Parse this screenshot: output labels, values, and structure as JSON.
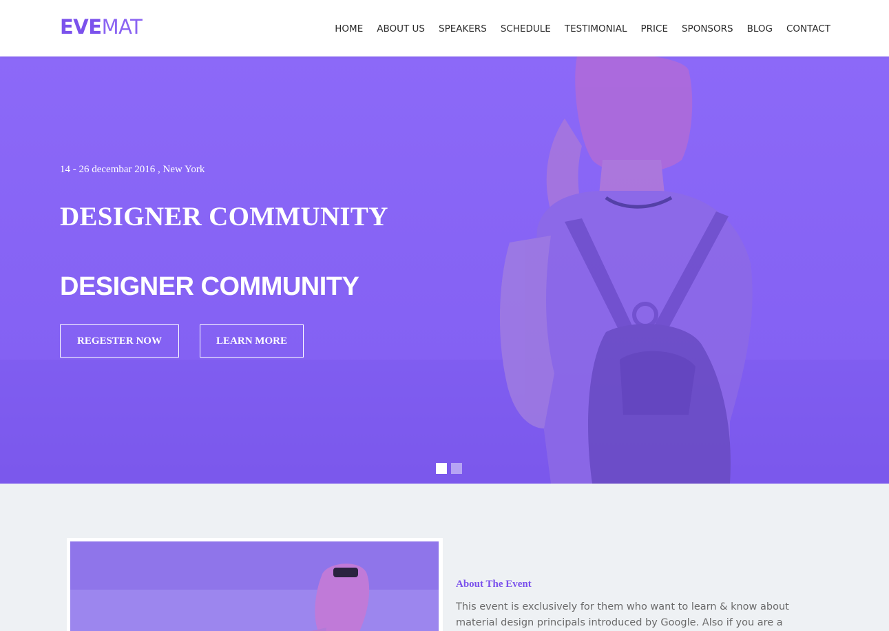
{
  "header": {
    "logo_bold": "EVE",
    "logo_light": "MAT",
    "nav": [
      "HOME",
      "ABOUT US",
      "SPEAKERS",
      "SCHEDULE",
      "TESTIMONIAL",
      "PRICE",
      "SPONSORS",
      "BLOG",
      "CONTACT"
    ]
  },
  "hero": {
    "date": "14 - 26 decembar 2016 , New York",
    "title_serif": "DESIGNER COMMUNITY",
    "title_sans": "DESIGNER COMMUNITY",
    "register_label": "REGESTER NOW",
    "learn_label": "LEARN MORE",
    "slides_total": 2,
    "active_slide": 1
  },
  "about": {
    "heading": "About The Event",
    "text": "This event is exclusively for them who want to learn & know about material design principals introduced by Google.  Also if you are a designer, then You"
  },
  "colors": {
    "accent": "#7b52ec",
    "hero_overlay": "#8b66f7",
    "section_bg": "#eef1f4"
  }
}
